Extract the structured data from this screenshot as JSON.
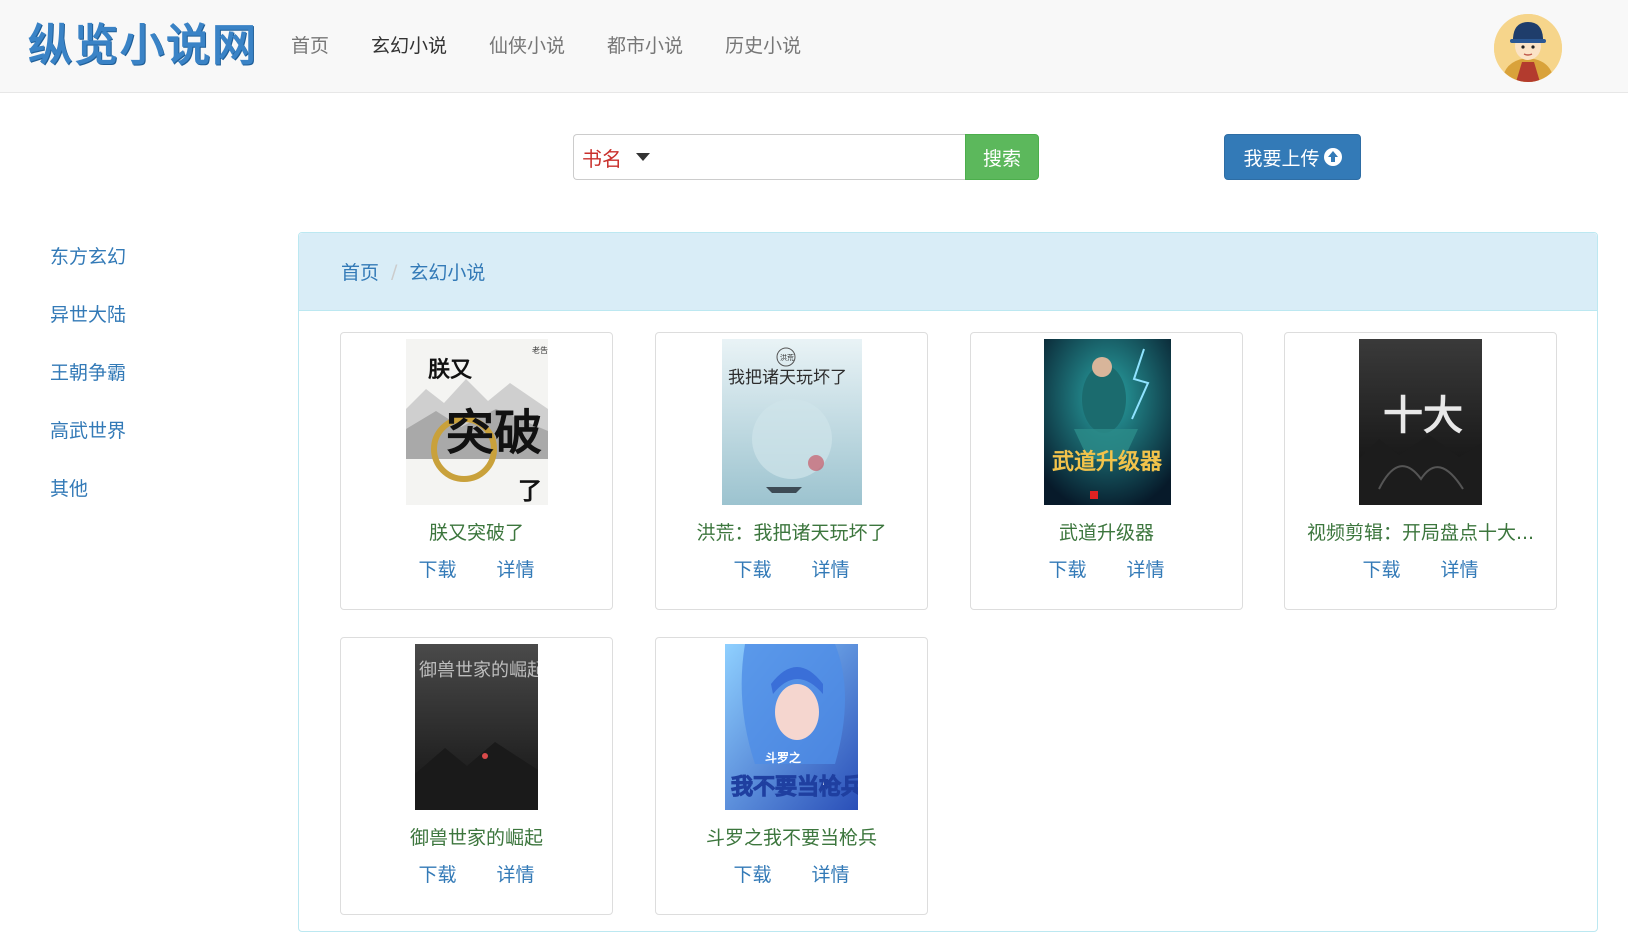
{
  "brand": "纵览小说网",
  "nav": [
    "首页",
    "玄幻小说",
    "仙侠小说",
    "都市小说",
    "历史小说"
  ],
  "search": {
    "field": "书名",
    "query": "",
    "button": "搜索"
  },
  "upload_label": "我要上传",
  "sidebar": [
    "东方玄幻",
    "异世大陆",
    "王朝争霸",
    "高武世界",
    "其他"
  ],
  "breadcrumb": [
    "首页",
    "玄幻小说"
  ],
  "books": [
    {
      "title": "朕又突破了",
      "download": "下载",
      "detail": "详情",
      "cover_author": "老告◎著",
      "cover_big": "突破",
      "cover_small": "朕又",
      "cover_tail": "了"
    },
    {
      "title": "洪荒：我把诸天玩坏了",
      "download": "下载",
      "detail": "详情",
      "cover_series": "洪荒",
      "cover_title": "我把诸天玩坏了"
    },
    {
      "title": "武道升级器",
      "download": "下载",
      "detail": "详情",
      "cover_title": "武道升级器"
    },
    {
      "title": "视频剪辑：开局盘点十大...",
      "download": "下载",
      "detail": "详情",
      "cover_title": "十大"
    },
    {
      "title": "御兽世家的崛起",
      "download": "下载",
      "detail": "详情",
      "cover_title": "御兽世家的崛起"
    },
    {
      "title": "斗罗之我不要当枪兵",
      "download": "下载",
      "detail": "详情",
      "cover_series": "斗罗之",
      "cover_title": "我不要当枪兵"
    }
  ]
}
